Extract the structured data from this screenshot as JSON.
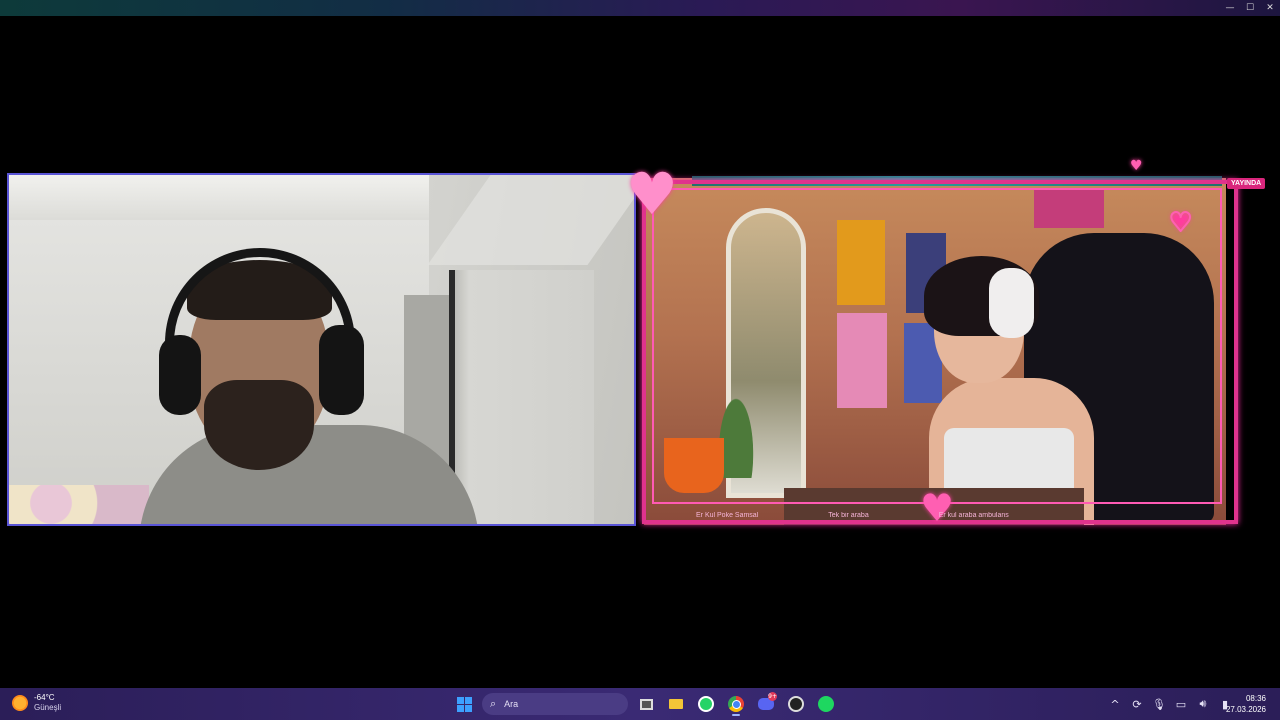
{
  "window": {
    "controls": {
      "minimize": "—",
      "maximize": "☐",
      "close": "✕"
    }
  },
  "stream": {
    "live_badge": "YAYINDA",
    "ticker": [
      "Er Kul Poke Samsal",
      "Tek bir araba",
      "Er kul araba ambulans"
    ]
  },
  "taskbar": {
    "weather": {
      "temp": "-64°C",
      "condition": "Güneşli"
    },
    "search": {
      "placeholder": "Ara"
    },
    "apps": [
      {
        "name": "task-view",
        "icon": "task-view-icon"
      },
      {
        "name": "file-explorer",
        "icon": "folder-icon"
      },
      {
        "name": "whatsapp",
        "icon": "whatsapp-icon"
      },
      {
        "name": "chrome",
        "icon": "chrome-icon",
        "active": true
      },
      {
        "name": "discord",
        "icon": "discord-icon",
        "badge": "9+"
      },
      {
        "name": "obs",
        "icon": "obs-icon"
      },
      {
        "name": "spotify",
        "icon": "spotify-icon"
      }
    ],
    "tray": {
      "chevron": "^",
      "icons": [
        "sync-icon",
        "microphone-icon",
        "display-icon",
        "volume-icon",
        "battery-icon"
      ]
    },
    "clock": {
      "time": "08:36",
      "date": "27.03.2026"
    }
  },
  "colors": {
    "taskbar": "#3a2a74",
    "left_border": "#5a55d6",
    "frame_pink": "#e0338d"
  }
}
